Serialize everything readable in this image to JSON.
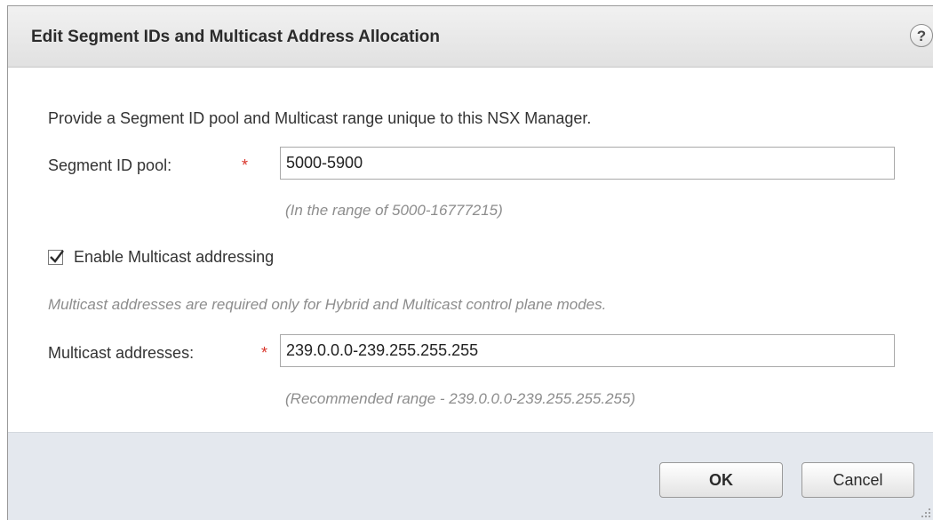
{
  "dialog": {
    "title": "Edit Segment IDs and Multicast Address Allocation",
    "help_icon": "?"
  },
  "form": {
    "intro": "Provide a Segment ID pool and Multicast range unique to this NSX Manager.",
    "segment_id": {
      "label": "Segment ID pool:",
      "required_mark": "*",
      "value": "5000-5900",
      "hint": "(In the range of 5000-16777215)"
    },
    "multicast": {
      "checkbox_label": "Enable Multicast addressing",
      "checked": true,
      "note": "Multicast addresses are required only for Hybrid and Multicast control plane modes.",
      "label": "Multicast addresses:",
      "required_mark": "*",
      "value": "239.0.0.0-239.255.255.255",
      "hint": "(Recommended range -  239.0.0.0-239.255.255.255)"
    }
  },
  "buttons": {
    "ok": "OK",
    "cancel": "Cancel"
  },
  "colors": {
    "required": "#d9352b",
    "footer_bg": "#e4e8ee",
    "hint_text": "#8d8d8d"
  }
}
